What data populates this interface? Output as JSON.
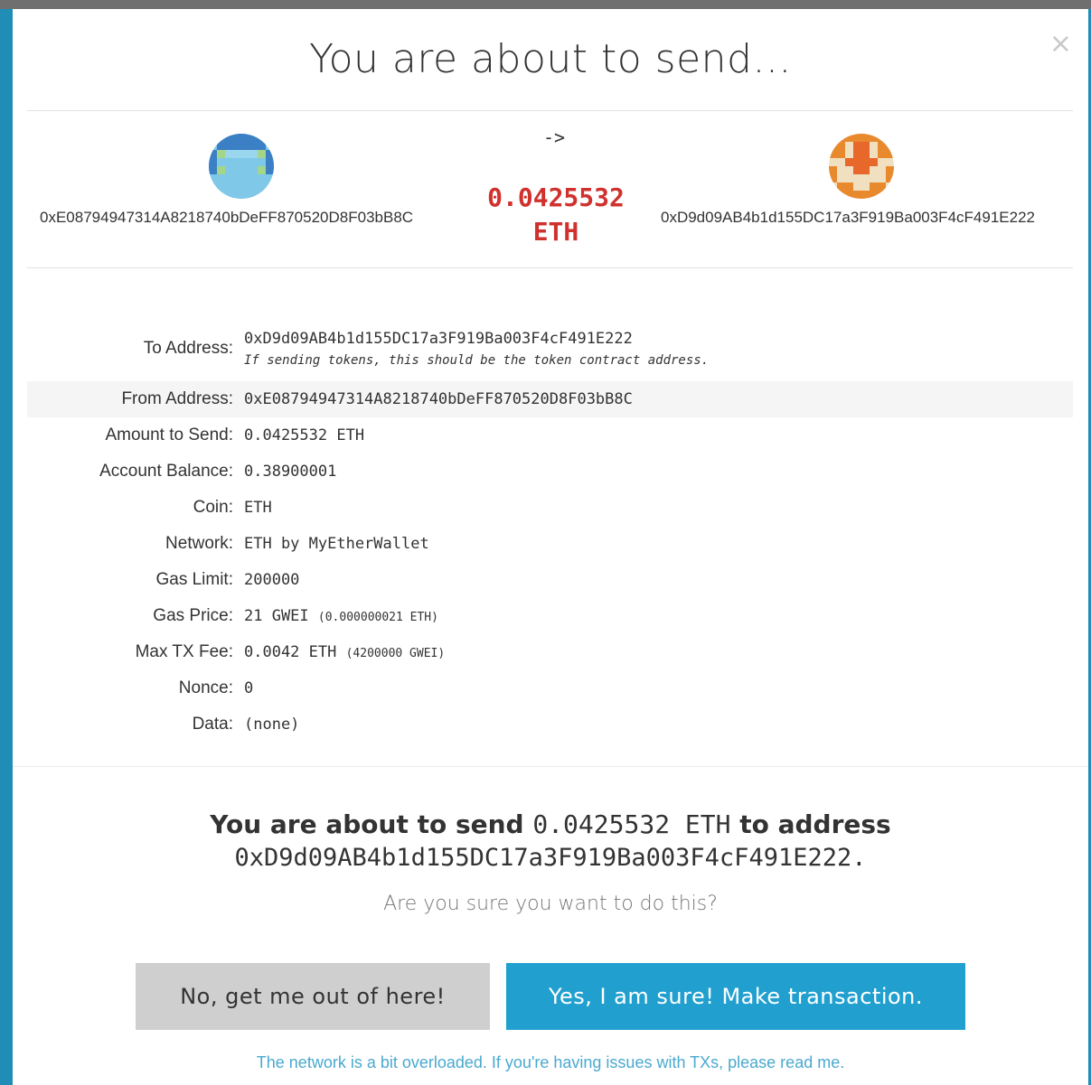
{
  "modal": {
    "title": "You are about to send...",
    "close_glyph": "×"
  },
  "summary": {
    "from_address": "0xE08794947314A8218740bDeFF870520D8F03bB8C",
    "to_address": "0xD9d09AB4b1d155DC17a3F919Ba003F4cF491E222",
    "arrow": "->",
    "amount": "0.0425532",
    "unit": "ETH"
  },
  "details": {
    "to_label": "To Address:",
    "to_value": "0xD9d09AB4b1d155DC17a3F919Ba003F4cF491E222",
    "to_hint": "If sending tokens, this should be the token contract address.",
    "from_label": "From Address:",
    "from_value": "0xE08794947314A8218740bDeFF870520D8F03bB8C",
    "amount_label": "Amount to Send:",
    "amount_value": "0.0425532 ETH",
    "balance_label": "Account Balance:",
    "balance_value": "0.38900001",
    "coin_label": "Coin:",
    "coin_value": "ETH",
    "network_label": "Network:",
    "network_value": "ETH by MyEtherWallet",
    "gaslimit_label": "Gas Limit:",
    "gaslimit_value": "200000",
    "gasprice_label": "Gas Price:",
    "gasprice_value": "21 GWEI",
    "gasprice_sub": "(0.000000021 ETH)",
    "maxfee_label": "Max TX Fee:",
    "maxfee_value": "0.0042 ETH",
    "maxfee_sub": "(4200000 GWEI)",
    "nonce_label": "Nonce:",
    "nonce_value": "0",
    "data_label": "Data:",
    "data_value": "(none)"
  },
  "confirm": {
    "prefix": "You are about to send",
    "amount": "0.0425532 ETH",
    "middle": "to address",
    "address": "0xD9d09AB4b1d155DC17a3F919Ba003F4cF491E222.",
    "question": "Are you sure you want to do this?",
    "no_button": "No, get me out of here!",
    "yes_button": "Yes, I am sure! Make transaction.",
    "network_note": "The network is a bit overloaded. If you're having issues with TXs, please read me."
  },
  "colors": {
    "amount_red": "#d0312d",
    "primary_blue": "#21a0cf",
    "cancel_gray": "#cfcfcf",
    "link_blue": "#4aa9cf"
  },
  "icons": {
    "from_avatar": "identicon-blue",
    "to_avatar": "identicon-orange"
  }
}
